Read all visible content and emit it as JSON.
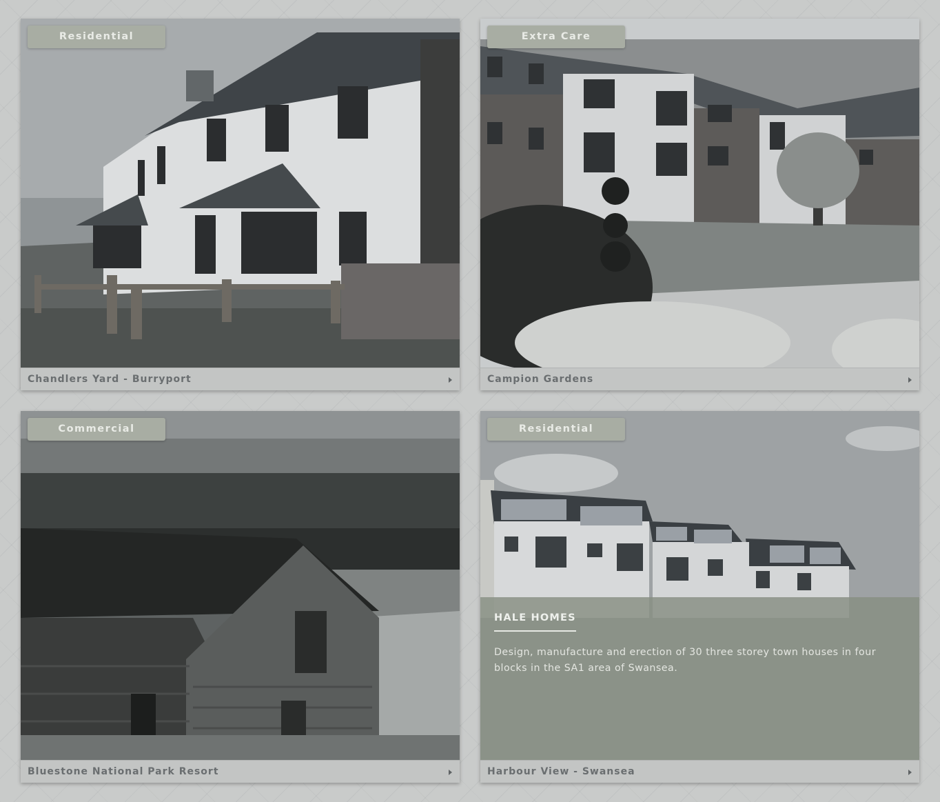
{
  "projects": [
    {
      "category": "Residential",
      "title": "Chandlers Yard - Burryport"
    },
    {
      "category": "Extra Care",
      "title": "Campion Gardens"
    },
    {
      "category": "Commercial",
      "title": "Bluestone National Park Resort"
    },
    {
      "category": "Residential",
      "title": "Harbour View - Swansea",
      "overlay": {
        "heading": "HALE HOMES",
        "description": "Design, manufacture and erection of 30 three storey town houses in four blocks in the SA1 area of Swansea."
      }
    }
  ],
  "icons": {
    "caption_arrow": "caret-right-icon"
  }
}
